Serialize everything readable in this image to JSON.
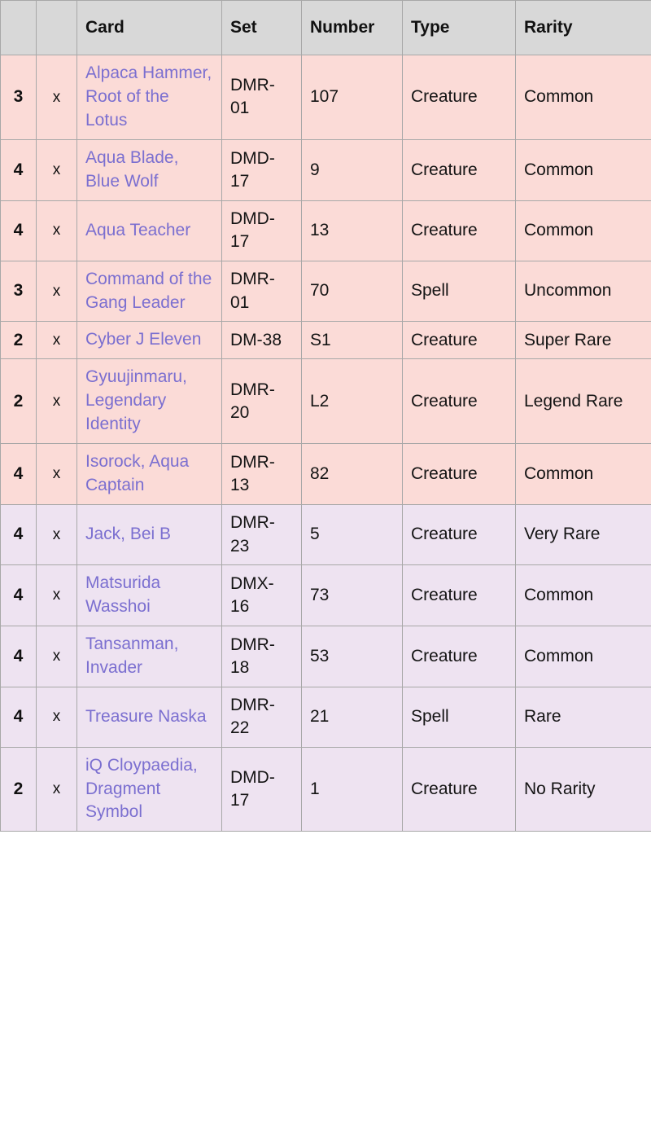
{
  "table": {
    "columns": [
      {
        "key": "count",
        "label": ""
      },
      {
        "key": "times",
        "label": ""
      },
      {
        "key": "card",
        "label": "Card"
      },
      {
        "key": "set",
        "label": "Set"
      },
      {
        "key": "number",
        "label": "Number"
      },
      {
        "key": "type",
        "label": "Type"
      },
      {
        "key": "rarity",
        "label": "Rarity"
      }
    ],
    "headers": {
      "blank_count": "",
      "blank_x": "",
      "card": "Card",
      "set": "Set",
      "number": "Number",
      "type": "Type",
      "rarity": "Rarity"
    },
    "multiplier_symbol": "x",
    "colors": {
      "header_bg": "#d8d8d8",
      "row_pink_bg": "#fbdbd7",
      "row_lavender_bg": "#eee3f1",
      "border": "#a8a8a8",
      "link": "#7b6fd0",
      "text": "#111111"
    },
    "rows": [
      {
        "count": "3",
        "times": "x",
        "card": "Alpaca Hammer, Root of the Lotus",
        "set": "DMR-01",
        "number": "107",
        "type": "Creature",
        "rarity": "Common",
        "tint": "pink"
      },
      {
        "count": "4",
        "times": "x",
        "card": "Aqua Blade, Blue Wolf",
        "set": "DMD-17",
        "number": "9",
        "type": "Creature",
        "rarity": "Common",
        "tint": "pink"
      },
      {
        "count": "4",
        "times": "x",
        "card": "Aqua Teacher",
        "set": "DMD-17",
        "number": "13",
        "type": "Creature",
        "rarity": "Common",
        "tint": "pink"
      },
      {
        "count": "3",
        "times": "x",
        "card": "Command of the Gang Leader",
        "set": "DMR-01",
        "number": "70",
        "type": "Spell",
        "rarity": "Uncommon",
        "tint": "pink"
      },
      {
        "count": "2",
        "times": "x",
        "card": "Cyber J Eleven",
        "set": "DM-38",
        "number": "S1",
        "type": "Creature",
        "rarity": "Super Rare",
        "tint": "pink"
      },
      {
        "count": "2",
        "times": "x",
        "card": "Gyuujinmaru, Legendary Identity",
        "set": "DMR-20",
        "number": "L2",
        "type": "Creature",
        "rarity": "Legend Rare",
        "tint": "pink"
      },
      {
        "count": "4",
        "times": "x",
        "card": "Isorock, Aqua Captain",
        "set": "DMR-13",
        "number": "82",
        "type": "Creature",
        "rarity": "Common",
        "tint": "pink"
      },
      {
        "count": "4",
        "times": "x",
        "card": "Jack, Bei B",
        "set": "DMR-23",
        "number": "5",
        "type": "Creature",
        "rarity": "Very Rare",
        "tint": "lav"
      },
      {
        "count": "4",
        "times": "x",
        "card": "Matsurida Wasshoi",
        "set": "DMX-16",
        "number": "73",
        "type": "Creature",
        "rarity": "Common",
        "tint": "lav"
      },
      {
        "count": "4",
        "times": "x",
        "card": "Tansanman, Invader",
        "set": "DMR-18",
        "number": "53",
        "type": "Creature",
        "rarity": "Common",
        "tint": "lav"
      },
      {
        "count": "4",
        "times": "x",
        "card": "Treasure Naska",
        "set": "DMR-22",
        "number": "21",
        "type": "Spell",
        "rarity": "Rare",
        "tint": "lav"
      },
      {
        "count": "2",
        "times": "x",
        "card": "iQ Cloypaedia, Dragment Symbol",
        "set": "DMD-17",
        "number": "1",
        "type": "Creature",
        "rarity": "No Rarity",
        "tint": "lav"
      }
    ]
  }
}
